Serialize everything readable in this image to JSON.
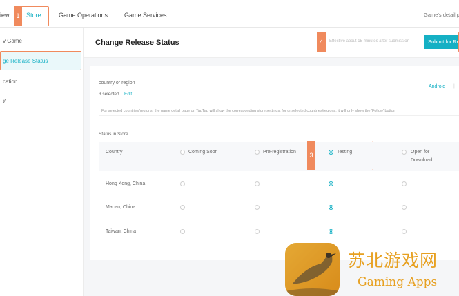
{
  "nav": {
    "overview": "iew",
    "store": "Store",
    "game_operations": "Game Operations",
    "game_services": "Game Services",
    "right_text": "Game's detail p"
  },
  "sidebar": {
    "items": [
      {
        "label": "v Game"
      },
      {
        "label": "ge Release Status"
      },
      {
        "label": "cation"
      },
      {
        "label": "y"
      }
    ]
  },
  "page": {
    "title": "Change Release Status",
    "effective_note": "Effective about 15 minutes after submission",
    "submit_label": "Submit for Re"
  },
  "region": {
    "label": "country or region",
    "selected": "3 selected",
    "edit": "Edit",
    "platform": "Android",
    "platform_sep": "|",
    "note": "For selected countries/regions, the game detail page on TapTap will show the corresponding store settings; for unselected countries/regions, it will only show the 'Follow' button"
  },
  "status": {
    "section_label": "Status in Store",
    "columns": {
      "country": "Country",
      "coming_soon": "Coming Soon",
      "pre_registration": "Pre-registration",
      "testing": "Testing",
      "open_line1": "Open for",
      "open_line2": "Download"
    },
    "rows": [
      {
        "country": "Hong Kong, China",
        "selected": "testing"
      },
      {
        "country": "Macau, China",
        "selected": "testing"
      },
      {
        "country": "Taiwan, China",
        "selected": "testing"
      }
    ]
  },
  "callouts": [
    "1",
    "3",
    "4"
  ],
  "watermark": {
    "cn": "苏北游戏网",
    "en": "Gaming Apps"
  },
  "colors": {
    "accent": "#15b0c4",
    "callout": "#f08a5d",
    "watermark": "#e7a020"
  }
}
